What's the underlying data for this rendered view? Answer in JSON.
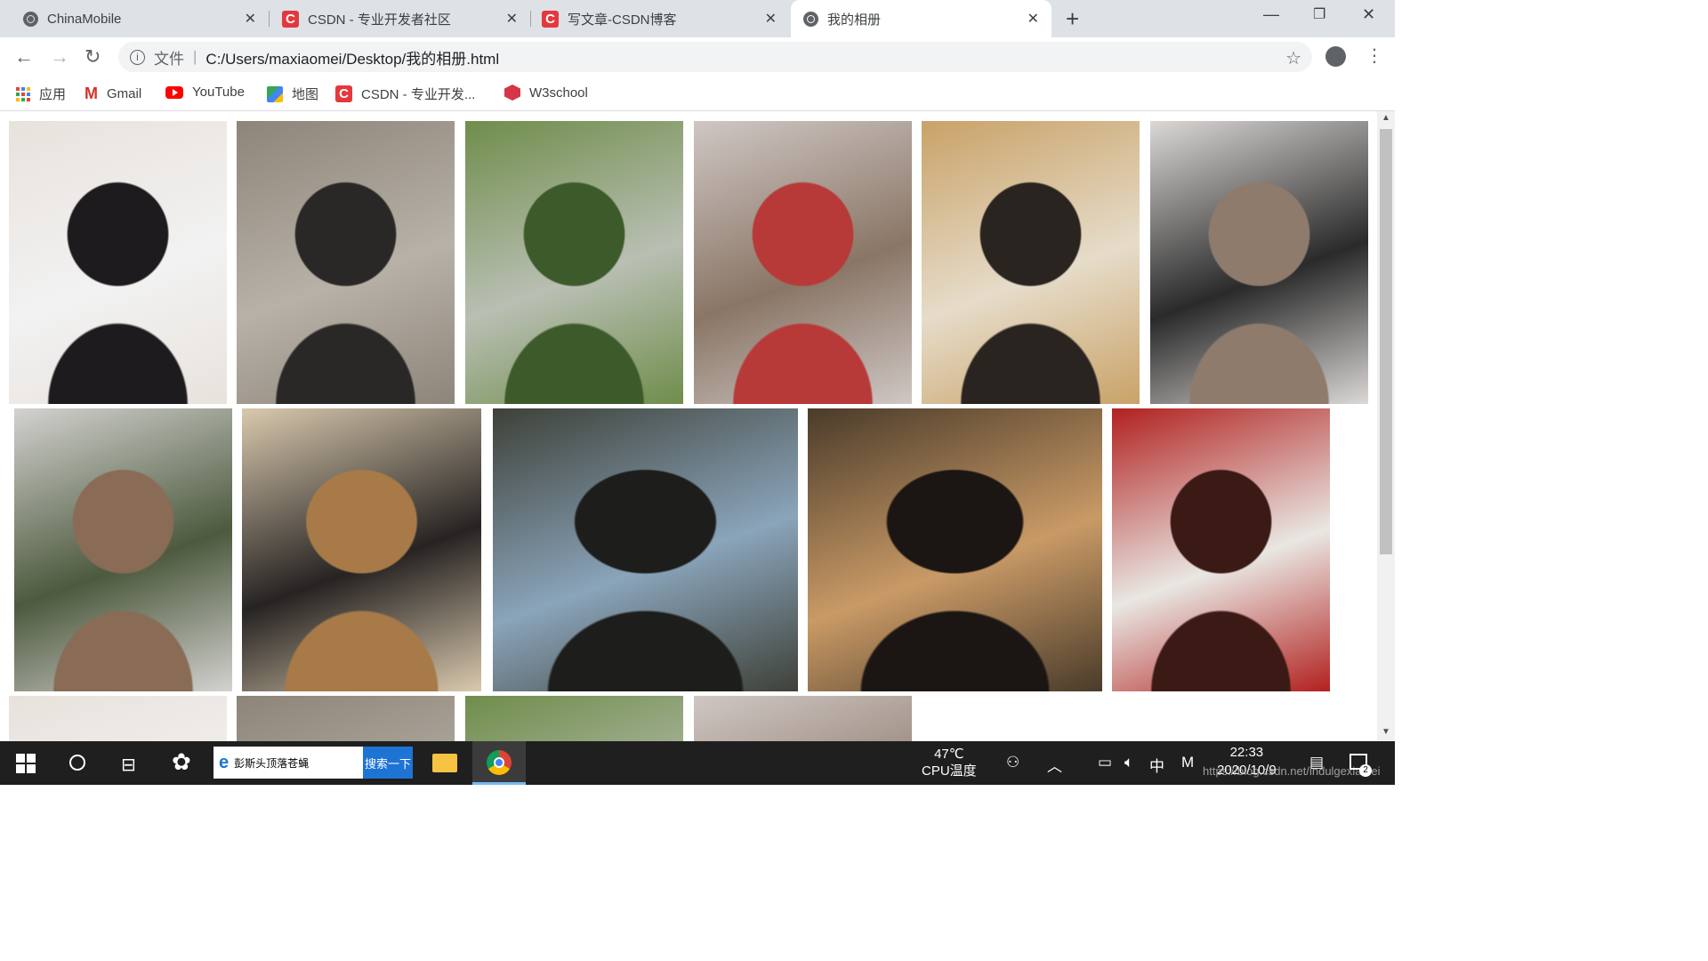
{
  "tabs": [
    {
      "title": "ChinaMobile",
      "icon": "globe-icon"
    },
    {
      "title": "CSDN - 专业开发者社区",
      "icon": "csdn-icon"
    },
    {
      "title": "写文章-CSDN博客",
      "icon": "csdn-icon"
    },
    {
      "title": "我的相册",
      "icon": "globe-icon",
      "active": true
    }
  ],
  "omnibox": {
    "scheme_label": "文件",
    "url": "C:/Users/maxiaomei/Desktop/我的相册.html"
  },
  "bookmarks": [
    {
      "label": "应用",
      "icon": "apps-grid-icon"
    },
    {
      "label": "Gmail",
      "icon": "gmail-icon"
    },
    {
      "label": "YouTube",
      "icon": "youtube-icon"
    },
    {
      "label": "地图",
      "icon": "maps-icon"
    },
    {
      "label": "CSDN - 专业开发...",
      "icon": "csdn-icon"
    },
    {
      "label": "W3school",
      "icon": "w3school-icon"
    }
  ],
  "photos": [
    {
      "subject": "girl-in-subway",
      "colors": [
        "#e8e2dc",
        "#1d1b1d",
        "#f2f2f2"
      ]
    },
    {
      "subject": "girl-on-escalator",
      "colors": [
        "#8d8579",
        "#2a2826",
        "#b8b1a7"
      ]
    },
    {
      "subject": "girl-walking-tree-lined-road",
      "colors": [
        "#6f8d4b",
        "#3d5a2a",
        "#b9bfb3"
      ]
    },
    {
      "subject": "girl-by-red-wall-pagoda",
      "colors": [
        "#cfc7c4",
        "#b73a38",
        "#8a7666"
      ]
    },
    {
      "subject": "girl-profile-masked",
      "colors": [
        "#c9a268",
        "#2a2420",
        "#e6dcc9"
      ]
    },
    {
      "subject": "girl-with-pagoda",
      "colors": [
        "#dbd8d6",
        "#8f7b6c",
        "#2a2a2a"
      ]
    },
    {
      "subject": "big-wild-goose-pagoda",
      "colors": [
        "#d3d2d0",
        "#8a6b55",
        "#4d5a3e"
      ]
    },
    {
      "subject": "girl-in-bookstore",
      "colors": [
        "#d9c9ae",
        "#a77a47",
        "#262322"
      ]
    },
    {
      "subject": "mirror-selfie",
      "colors": [
        "#3e4138",
        "#1d1d1b",
        "#8aa4ba"
      ]
    },
    {
      "subject": "girl-warm-bokeh",
      "colors": [
        "#4a3b2a",
        "#1b1613",
        "#c99a66"
      ]
    },
    {
      "subject": "girl-neon-sign",
      "colors": [
        "#b1211f",
        "#3b1a16",
        "#e9e7e3"
      ]
    },
    {
      "subject": "girl-in-subway",
      "colors": [
        "#e8e2dc",
        "#1d1b1d",
        "#f2f2f2"
      ]
    },
    {
      "subject": "girl-on-escalator",
      "colors": [
        "#8d8579",
        "#2a2826",
        "#b8b1a7"
      ]
    },
    {
      "subject": "girl-walking-tree-lined-road",
      "colors": [
        "#6f8d4b",
        "#3d5a2a",
        "#b9bfb3"
      ]
    },
    {
      "subject": "girl-by-red-wall-pagoda",
      "colors": [
        "#cfc7c4",
        "#b73a38",
        "#8a7666"
      ]
    }
  ],
  "taskbar": {
    "search_text": "彭斯头顶落苍蝇",
    "search_button": "搜索一下",
    "temp_value": "47℃",
    "temp_label": "CPU温度",
    "ime": "中",
    "ime_mode": "M",
    "time": "22:33",
    "date": "2020/10/9",
    "watermark": "https://blog.csdn.net/indulgexiamei",
    "notification_count": "2"
  }
}
